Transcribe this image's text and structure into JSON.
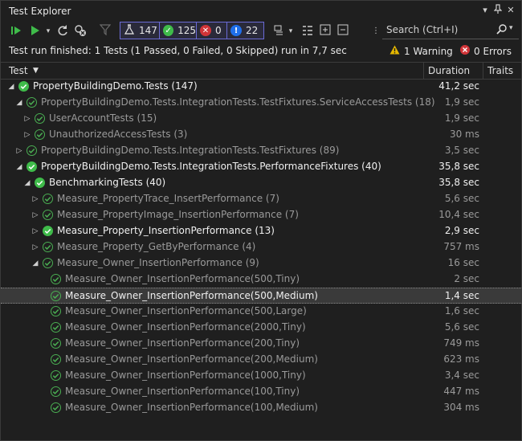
{
  "window": {
    "title": "Test Explorer"
  },
  "toolbar": {
    "total_count": "147",
    "passed_count": "125",
    "failed_count": "0",
    "notrun_count": "22",
    "search_placeholder": "Search (Ctrl+I)"
  },
  "status": {
    "message": "Test run finished: 1 Tests (1 Passed, 0 Failed, 0 Skipped) run in 7,7 sec",
    "warnings": "1 Warning",
    "errors": "0 Errors"
  },
  "columns": {
    "test": "Test",
    "duration": "Duration",
    "traits": "Traits"
  },
  "colors": {
    "passed": "#3fbb4a",
    "failed": "#d13438",
    "info": "#1f6feb",
    "accent": "#6b6bd6",
    "warning": "#e5b700"
  },
  "rows": [
    {
      "name": "PropertyBuildingDemo.Tests (147)",
      "duration": "41,2 sec",
      "indent": 0,
      "expander": "down",
      "icon": "solid",
      "tone": "bright"
    },
    {
      "name": "PropertyBuildingDemo.Tests.IntegrationTests.TestFixtures.ServiceAccessTests (18)",
      "duration": "1,9 sec",
      "indent": 1,
      "expander": "down",
      "icon": "hollow",
      "tone": "dim"
    },
    {
      "name": "UserAccountTests (15)",
      "duration": "1,9 sec",
      "indent": 2,
      "expander": "right",
      "icon": "hollow",
      "tone": "dim"
    },
    {
      "name": "UnauthorizedAccessTests (3)",
      "duration": "30 ms",
      "indent": 2,
      "expander": "right",
      "icon": "hollow",
      "tone": "dim"
    },
    {
      "name": "PropertyBuildingDemo.Tests.IntegrationTests.TestFixtures (89)",
      "duration": "3,5 sec",
      "indent": 1,
      "expander": "right",
      "icon": "hollow",
      "tone": "dim"
    },
    {
      "name": "PropertyBuildingDemo.Tests.IntegrationTests.PerformanceFixtures (40)",
      "duration": "35,8 sec",
      "indent": 1,
      "expander": "down",
      "icon": "solid",
      "tone": "bright"
    },
    {
      "name": "BenchmarkingTests (40)",
      "duration": "35,8 sec",
      "indent": 2,
      "expander": "down",
      "icon": "solid",
      "tone": "bright"
    },
    {
      "name": "Measure_PropertyTrace_InsertPerformance (7)",
      "duration": "5,6 sec",
      "indent": 3,
      "expander": "right",
      "icon": "hollow",
      "tone": "dim"
    },
    {
      "name": "Measure_PropertyImage_InsertionPerformance (7)",
      "duration": "10,4 sec",
      "indent": 3,
      "expander": "right",
      "icon": "hollow",
      "tone": "dim"
    },
    {
      "name": "Measure_Property_InsertionPerformance (13)",
      "duration": "2,9 sec",
      "indent": 3,
      "expander": "right",
      "icon": "solid",
      "tone": "bright"
    },
    {
      "name": "Measure_Property_GetByPerformance (4)",
      "duration": "757 ms",
      "indent": 3,
      "expander": "right",
      "icon": "hollow",
      "tone": "dim"
    },
    {
      "name": "Measure_Owner_InsertionPerformance (9)",
      "duration": "16 sec",
      "indent": 3,
      "expander": "down",
      "icon": "hollow",
      "tone": "dim"
    },
    {
      "name": "Measure_Owner_InsertionPerformance(500,Tiny)",
      "duration": "2 sec",
      "indent": 4,
      "expander": "",
      "icon": "hollow",
      "tone": "dim"
    },
    {
      "name": "Measure_Owner_InsertionPerformance(500,Medium)",
      "duration": "1,4 sec",
      "indent": 4,
      "expander": "",
      "icon": "hollow",
      "tone": "bright",
      "selected": true
    },
    {
      "name": "Measure_Owner_InsertionPerformance(500,Large)",
      "duration": "1,6 sec",
      "indent": 4,
      "expander": "",
      "icon": "hollow",
      "tone": "dim"
    },
    {
      "name": "Measure_Owner_InsertionPerformance(2000,Tiny)",
      "duration": "5,6 sec",
      "indent": 4,
      "expander": "",
      "icon": "hollow",
      "tone": "dim"
    },
    {
      "name": "Measure_Owner_InsertionPerformance(200,Tiny)",
      "duration": "749 ms",
      "indent": 4,
      "expander": "",
      "icon": "hollow",
      "tone": "dim"
    },
    {
      "name": "Measure_Owner_InsertionPerformance(200,Medium)",
      "duration": "623 ms",
      "indent": 4,
      "expander": "",
      "icon": "hollow",
      "tone": "dim"
    },
    {
      "name": "Measure_Owner_InsertionPerformance(1000,Tiny)",
      "duration": "3,4 sec",
      "indent": 4,
      "expander": "",
      "icon": "hollow",
      "tone": "dim"
    },
    {
      "name": "Measure_Owner_InsertionPerformance(100,Tiny)",
      "duration": "447 ms",
      "indent": 4,
      "expander": "",
      "icon": "hollow",
      "tone": "dim"
    },
    {
      "name": "Measure_Owner_InsertionPerformance(100,Medium)",
      "duration": "304 ms",
      "indent": 4,
      "expander": "",
      "icon": "hollow",
      "tone": "dim"
    }
  ]
}
